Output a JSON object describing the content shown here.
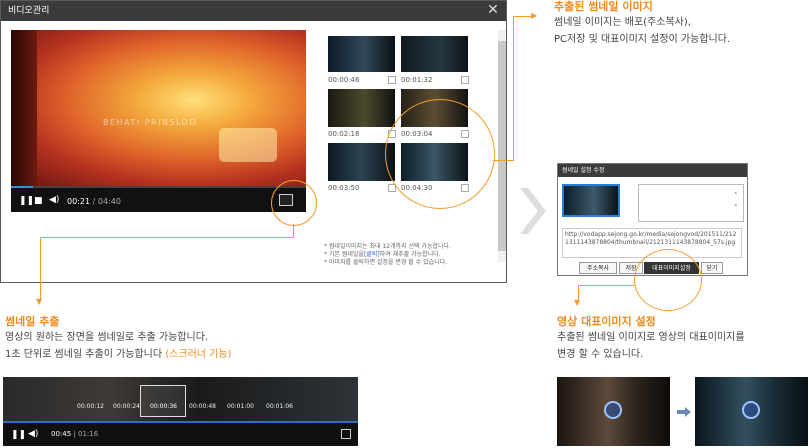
{
  "dialog": {
    "title": "비디오관리",
    "close_icon": "close-icon",
    "watermark": "BEHATI PRINSLOO",
    "time_current": "00:21",
    "time_total": "/ 04:40",
    "thumbnails": [
      {
        "time": "00:00:46"
      },
      {
        "time": "00:01:32"
      },
      {
        "time": "00:02:18"
      },
      {
        "time": "00:03:04"
      },
      {
        "time": "00:03:50"
      },
      {
        "time": "00:04:30"
      }
    ],
    "notes": [
      "* 썸네일이미지는 최대 12개까지 선택 가능합니다.",
      "* 기본 썸네일을",
      "[클릭]",
      "하여 재추출 가능합니다.",
      "* 이미지를 클릭하면 설정을 변경 할 수 있습니다."
    ]
  },
  "callouts": {
    "extracted": {
      "title": "추출된 썸네일 이미지",
      "line1": "썸네일 이미지는 배포(주소복사),",
      "line2": "PC저장 및 대표이미지 설정이 가능합니다."
    },
    "extract": {
      "title": "썸네일 추출",
      "line1": "영상의 원하는 장면을 썸네일로 추출 가능합니다.",
      "line2a": "1초 단위로 썸네일 추출이 가능합니다 ",
      "line2b": "(스크러너 기능)"
    },
    "representative": {
      "title": "영상 대표이미지 설정",
      "line1": "추출된 썸네일 이미지로 영상의 대표이미지를",
      "line2": "변경 할 수 있습니다."
    }
  },
  "small_dialog": {
    "title": "썸네일 설정 수정",
    "url": "http://vodapp.sejong.go.kr/media/sejongvod/201511/2121311143878804/thumbnail/2121311143878804_57s.jpg",
    "btn_copy": "주소복사",
    "btn_save": "저장",
    "btn_rep": "대표이미지설정",
    "btn_close": "닫기"
  },
  "scrubber": {
    "times": [
      "00:00:12",
      "00:00:24",
      "00:00:36",
      "00:00:48",
      "00:01:00",
      "00:01:06"
    ],
    "time_current": "00:45",
    "time_total": "| 01:16"
  },
  "colors": {
    "accent": "#f39c2b",
    "title_bar": "#3b3b3b",
    "progress": "#3a8dde"
  }
}
